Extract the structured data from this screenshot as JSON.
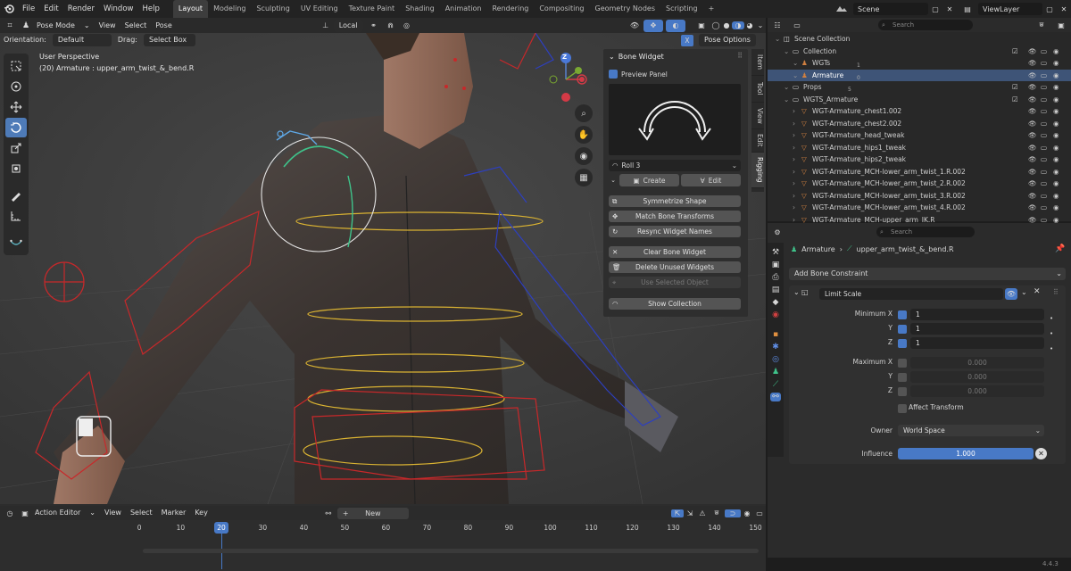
{
  "menubar": {
    "items": [
      "File",
      "Edit",
      "Render",
      "Window",
      "Help"
    ],
    "workspaces": [
      "Layout",
      "Modeling",
      "Sculpting",
      "UV Editing",
      "Texture Paint",
      "Shading",
      "Animation",
      "Rendering",
      "Compositing",
      "Geometry Nodes",
      "Scripting"
    ],
    "active_workspace": "Layout",
    "add_tab": "+",
    "scene": "Scene",
    "view_layer": "ViewLayer"
  },
  "viewport_header": {
    "mode": "Pose Mode",
    "menus": [
      "View",
      "Select",
      "Pose"
    ],
    "transform_orientation": "Local",
    "pose_options": "Pose Options",
    "x_axis": "X"
  },
  "tool_settings": {
    "orientation_label": "Orientation:",
    "orientation_value": "Default",
    "drag_label": "Drag:",
    "drag_value": "Select Box"
  },
  "viewport": {
    "view_name": "User Perspective",
    "object_info": "(20) Armature : upper_arm_twist_&_bend.R",
    "gizmo": {
      "x": "X",
      "y": "Y",
      "z": "Z"
    }
  },
  "sidebar_tabs": [
    "Item",
    "Tool",
    "View",
    "Edit",
    "Rigging"
  ],
  "sidebar_active_tab": "Rigging",
  "bone_widget": {
    "title": "Bone Widget",
    "preview_label": "Preview Panel",
    "shape": "Roll 3",
    "create": "Create",
    "edit": "Edit",
    "symmetrize": "Symmetrize Shape",
    "match": "Match Bone Transforms",
    "resync": "Resync Widget Names",
    "clear": "Clear Bone Widget",
    "delete_unused": "Delete Unused Widgets",
    "use_selected": "Use Selected Object",
    "show_collection": "Show Collection"
  },
  "outliner": {
    "search_placeholder": "Search",
    "rows": [
      {
        "name": "Scene Collection",
        "indent": 0,
        "type": "scene"
      },
      {
        "name": "Collection",
        "indent": 1,
        "type": "collection",
        "checked": true
      },
      {
        "name": "WGTs",
        "indent": 2,
        "type": "armature",
        "badge": "1"
      },
      {
        "name": "Armature",
        "indent": 2,
        "type": "armature",
        "selected": true,
        "badge": "0"
      },
      {
        "name": "Props",
        "indent": 1,
        "type": "collection",
        "badge": "5",
        "checked": true
      },
      {
        "name": "WGTS_Armature",
        "indent": 1,
        "type": "collection",
        "checked": true
      },
      {
        "name": "WGT-Armature_chest1.002",
        "indent": 2,
        "type": "mesh"
      },
      {
        "name": "WGT-Armature_chest2.002",
        "indent": 2,
        "type": "mesh"
      },
      {
        "name": "WGT-Armature_head_tweak",
        "indent": 2,
        "type": "mesh"
      },
      {
        "name": "WGT-Armature_hips1_tweak",
        "indent": 2,
        "type": "mesh"
      },
      {
        "name": "WGT-Armature_hips2_tweak",
        "indent": 2,
        "type": "mesh"
      },
      {
        "name": "WGT-Armature_MCH-lower_arm_twist_1.R.002",
        "indent": 2,
        "type": "mesh"
      },
      {
        "name": "WGT-Armature_MCH-lower_arm_twist_2.R.002",
        "indent": 2,
        "type": "mesh"
      },
      {
        "name": "WGT-Armature_MCH-lower_arm_twist_3.R.002",
        "indent": 2,
        "type": "mesh"
      },
      {
        "name": "WGT-Armature_MCH-lower_arm_twist_4.R.002",
        "indent": 2,
        "type": "mesh"
      },
      {
        "name": "WGT-Armature_MCH-upper_arm_IK.R",
        "indent": 2,
        "type": "mesh"
      }
    ]
  },
  "properties": {
    "search_placeholder": "Search",
    "breadcrumb": [
      "Armature",
      "upper_arm_twist_&_bend.R"
    ],
    "add_constraint": "Add Bone Constraint",
    "constraint": {
      "name": "Limit Scale",
      "min_label": "Minimum X",
      "min_values": [
        "1",
        "1",
        "1"
      ],
      "max_label": "Maximum X",
      "max_values": [
        "0.000",
        "0.000",
        "0.000"
      ],
      "axis_y": "Y",
      "axis_z": "Z",
      "affect_transform": "Affect Transform",
      "owner_label": "Owner",
      "owner_value": "World Space",
      "influence_label": "Influence",
      "influence_value": "1.000",
      "influence_fraction": 1.0
    }
  },
  "timeline": {
    "editor": "Action Editor",
    "menus": [
      "View",
      "Select",
      "Marker",
      "Key"
    ],
    "new_label": "New",
    "new_plus": "+",
    "current_frame": "20",
    "ticks": [
      "0",
      "10",
      "20",
      "30",
      "40",
      "50",
      "60",
      "70",
      "80",
      "90",
      "100",
      "110",
      "120",
      "130",
      "140",
      "150"
    ]
  },
  "version": "4.4.3",
  "colors": {
    "accent": "#4879c6",
    "selection": "#3e5477",
    "viewport_bg": "#3d3d3d",
    "bone_red": "#c8282a",
    "bone_yellow": "#d9b232",
    "bone_blue": "#2d3fbf",
    "bone_green": "#3fc28a"
  }
}
